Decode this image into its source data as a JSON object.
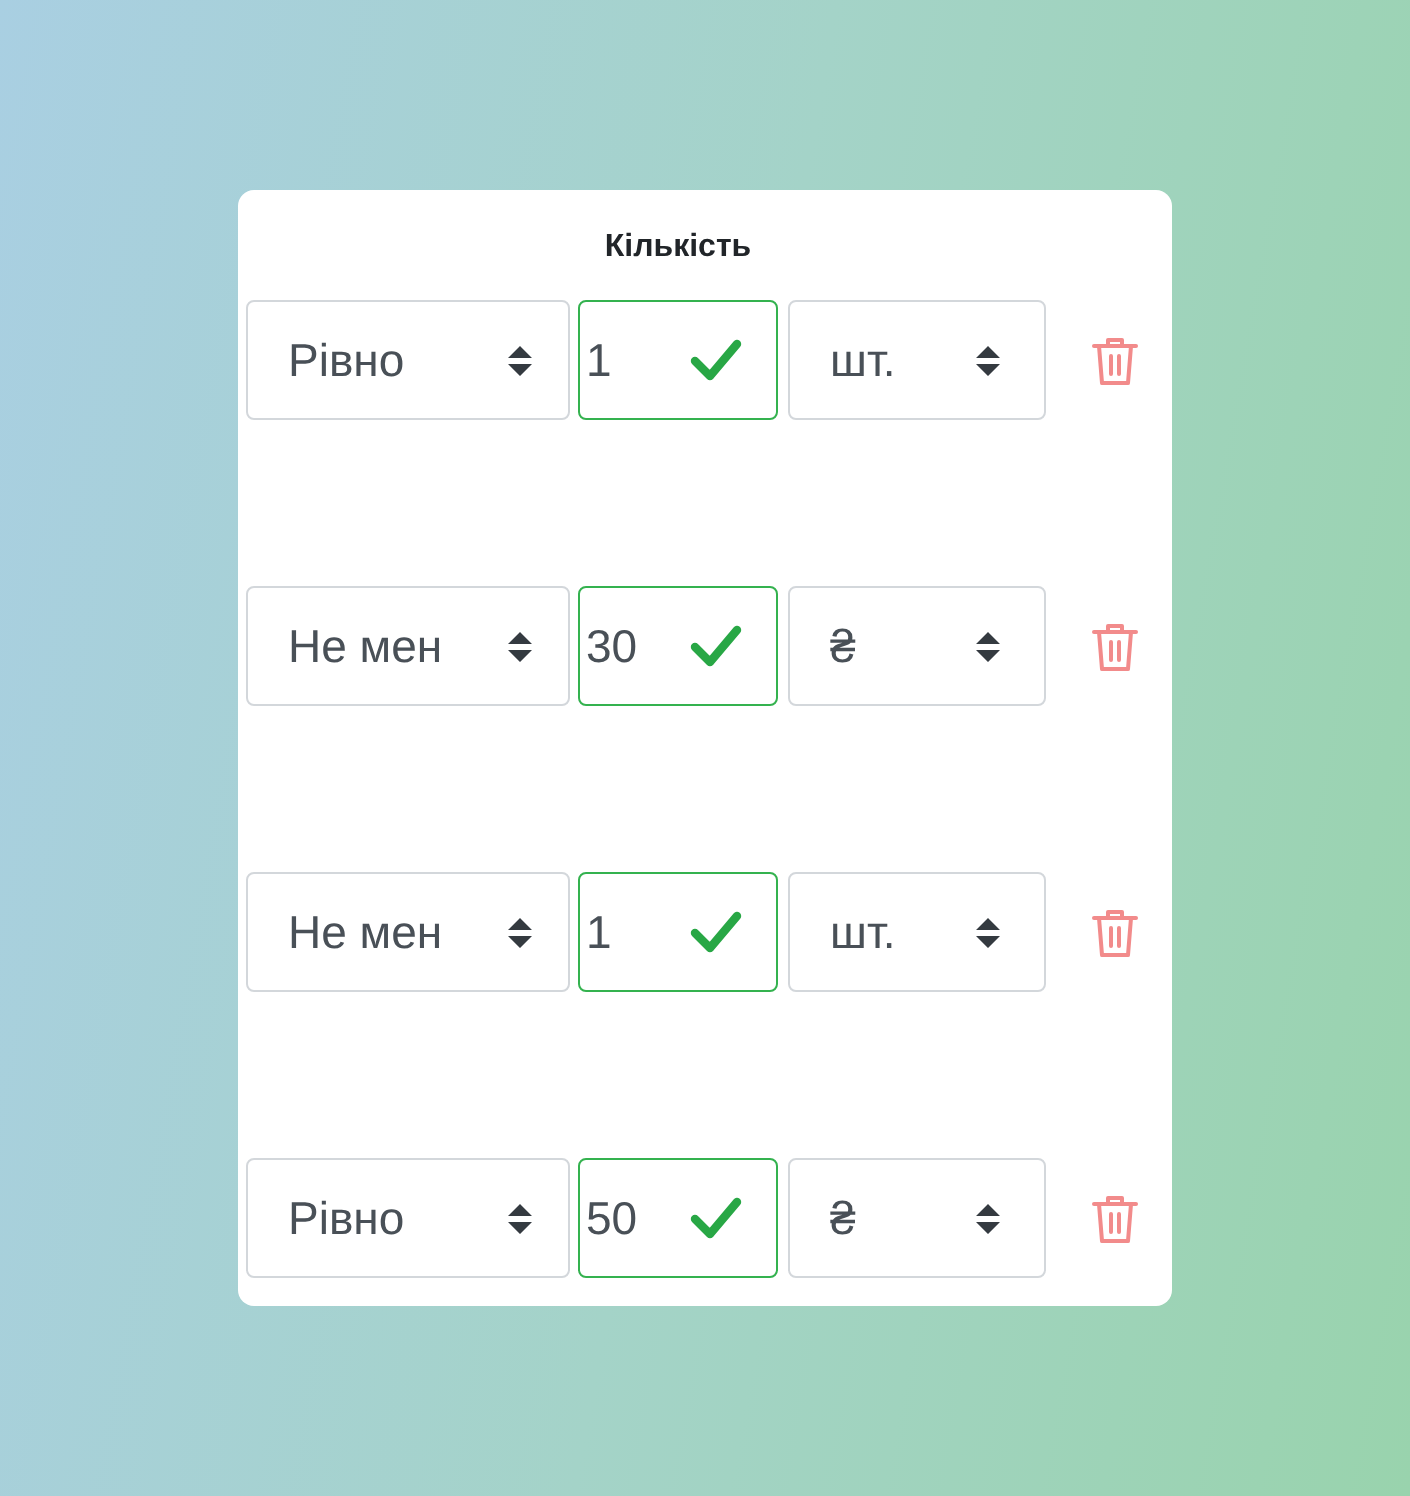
{
  "header": {
    "title": "Кількість"
  },
  "rows": [
    {
      "condition": "Рівно",
      "amount": "1",
      "valid": true,
      "unit": "шт."
    },
    {
      "condition": "Не мен",
      "amount": "30",
      "valid": true,
      "unit": "₴"
    },
    {
      "condition": "Не мен",
      "amount": "1",
      "valid": true,
      "unit": "шт."
    },
    {
      "condition": "Рівно",
      "amount": "50",
      "valid": true,
      "unit": "₴"
    }
  ]
}
